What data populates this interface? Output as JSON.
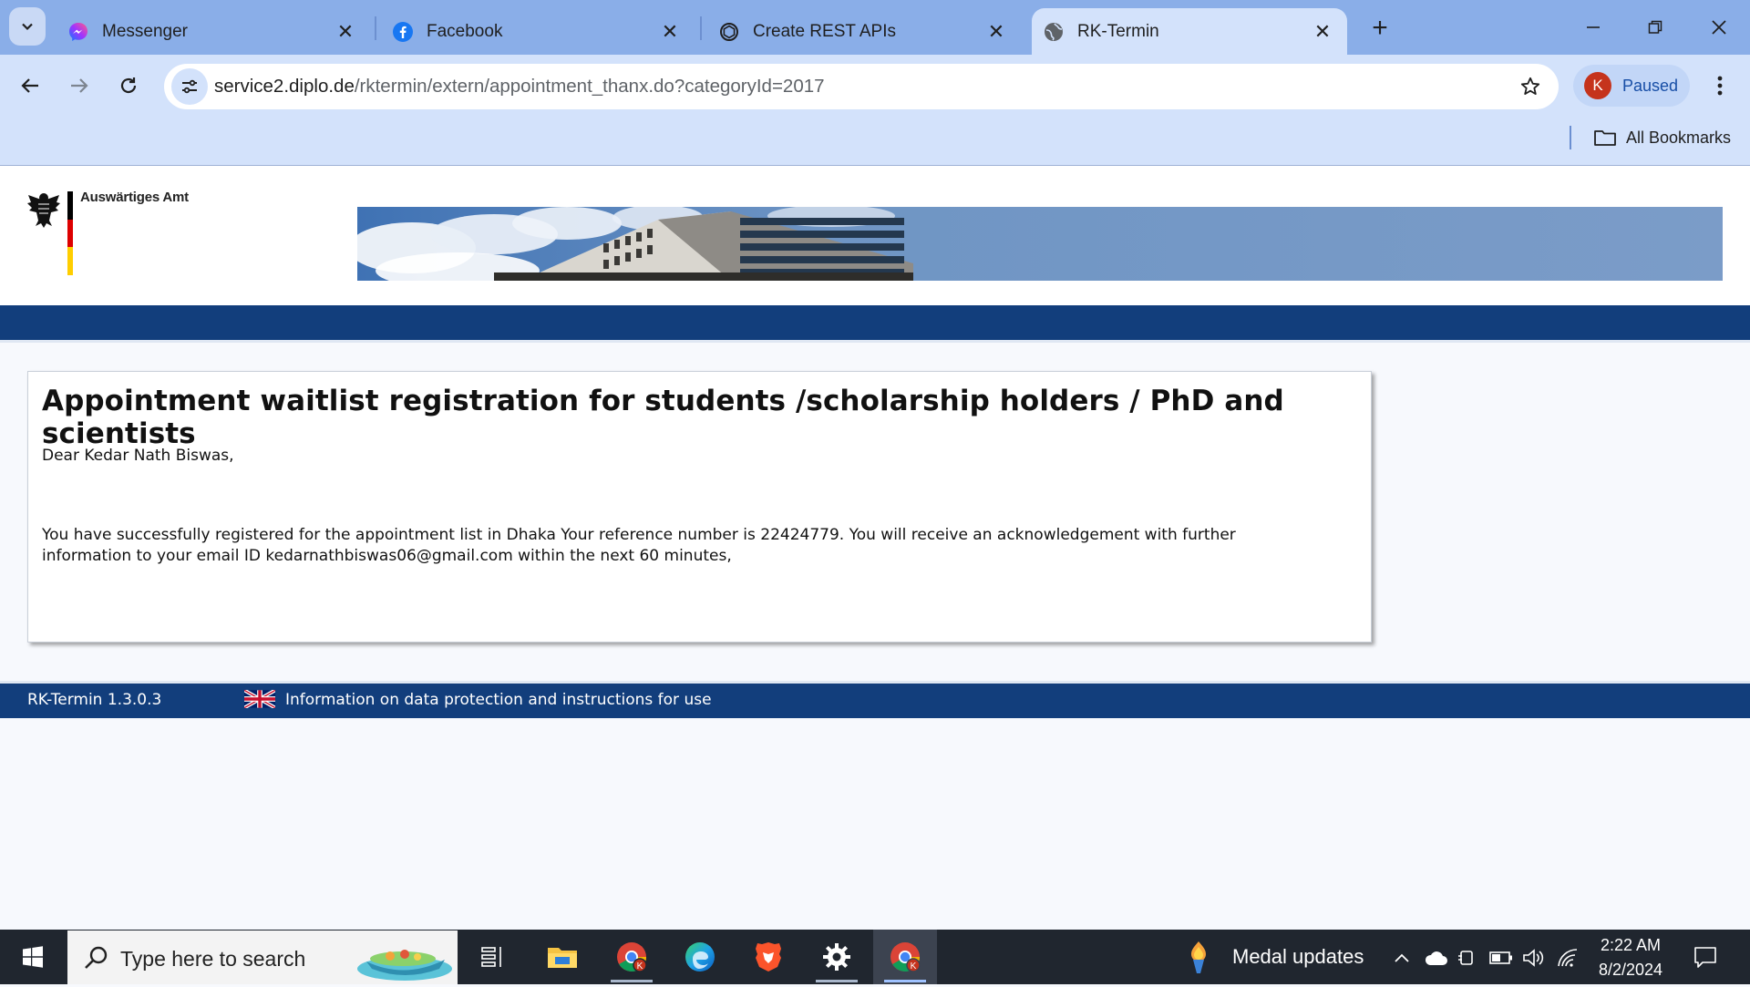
{
  "browser": {
    "tabs": [
      {
        "title": "Messenger",
        "icon": "messenger-icon",
        "active": false
      },
      {
        "title": "Facebook",
        "icon": "facebook-icon",
        "active": false
      },
      {
        "title": "Create REST APIs",
        "icon": "openai-icon",
        "active": false
      },
      {
        "title": "RK-Termin",
        "icon": "globe-icon",
        "active": true
      }
    ],
    "url": {
      "host": "service2.diplo.de",
      "path": "/rktermin/extern/appointment_thanx.do?categoryId=2017"
    },
    "profile": {
      "initial": "K",
      "status": "Paused",
      "avatar_color": "#c5331c"
    },
    "bookmarks": {
      "all_label": "All Bookmarks"
    }
  },
  "site": {
    "ministry_name": "Auswärtiges Amt",
    "heading": "Appointment waitlist registration for students /scholarship holders / PhD and scientists",
    "greeting": "Dear Kedar Nath Biswas,",
    "message": "You have successfully registered for the appointment list in Dhaka Your reference number is 22424779. You will receive an acknowledgement with further information to your email ID kedarnathbiswas06@gmail.com within the next 60 minutes,",
    "footer": {
      "version": "RK-Termin 1.3.0.3",
      "info_link": "Information on data protection and instructions for use"
    },
    "colors": {
      "nav_blue": "#123e7c"
    }
  },
  "taskbar": {
    "search_placeholder": "Type here to search",
    "apps": [
      "task-view-icon",
      "file-explorer-icon",
      "chrome-icon",
      "edge-icon",
      "brave-icon",
      "settings-icon",
      "chrome-icon"
    ],
    "notification": "Medal updates",
    "time": "2:22 AM",
    "date": "8/2/2024"
  }
}
